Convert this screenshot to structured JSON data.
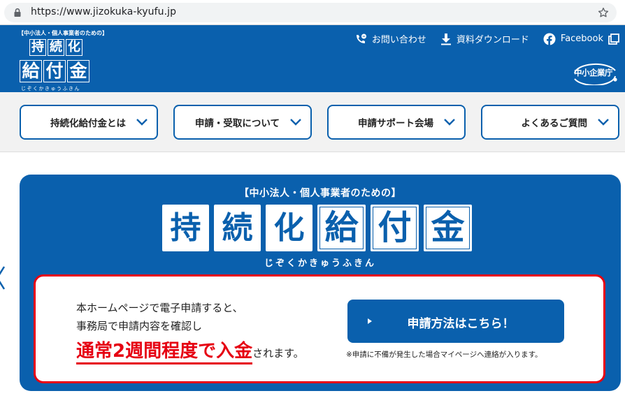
{
  "browser": {
    "url": "https://www.jizokuka-kyufu.jp"
  },
  "header": {
    "logo": {
      "tagline": "【中小法人・個人事業者のための】",
      "row1": [
        "持",
        "続",
        "化"
      ],
      "row2": [
        "給",
        "付",
        "金"
      ],
      "reading": "じぞくかきゅうふきん"
    },
    "links": {
      "contact": "お問い合わせ",
      "download": "資料ダウンロード",
      "facebook": "Facebook"
    },
    "agency_badge": "中小企業庁"
  },
  "nav": {
    "items": [
      {
        "label": "持続化給付金とは"
      },
      {
        "label": "申請・受取について"
      },
      {
        "label": "申請サポート会場"
      },
      {
        "label": "よくあるご質問"
      }
    ]
  },
  "hero": {
    "tagline": "【中小法人・個人事業者のための】",
    "tiles": [
      "持",
      "続",
      "化",
      "給",
      "付",
      "金"
    ],
    "reading": "じぞくかきゅうふきん",
    "panel": {
      "line1": "本ホームページで電子申請すると、",
      "line2": "事務局で申請内容を確認し",
      "highlight": "通常2週間程度で入金",
      "tail": "されます。",
      "cta_label": "申請方法はこちら！",
      "note": "※申請に不備が発生した場合マイページへ連絡が入ります。"
    }
  },
  "colors": {
    "brand_blue": "#0a60ad",
    "alert_red": "#e60012",
    "nav_background": "#f2f2f2"
  },
  "icons": {
    "lock": "lock-icon",
    "star": "star-icon",
    "contact": "phone-chat-icon",
    "download": "download-icon",
    "facebook": "facebook-icon",
    "external": "external-link-icon",
    "nav_chevron": "chevron-down-icon",
    "carousel_prev": "chevron-left-icon",
    "cta": "play-arrow-icon"
  }
}
